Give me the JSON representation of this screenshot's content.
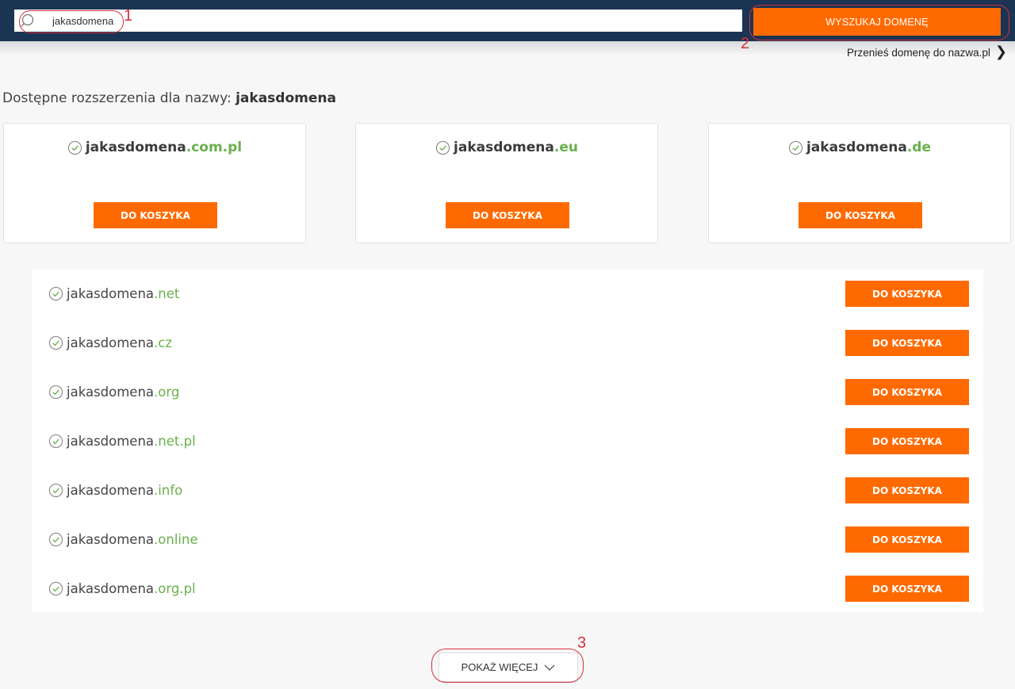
{
  "search": {
    "value": "jakasdomena",
    "button_label": "WYSZUKAJ DOMENĘ",
    "icon": "search-icon"
  },
  "transfer_link": {
    "label": "Przenieś domenę do nazwa.pl",
    "icon": "chevron-right-icon"
  },
  "heading": {
    "prefix": "Dostępne rozszerzenia dla nazwy: ",
    "name": "jakasdomena"
  },
  "featured": [
    {
      "name": "jakasdomena",
      "ext": ".com.pl",
      "button": "DO KOSZYKA"
    },
    {
      "name": "jakasdomena",
      "ext": ".eu",
      "button": "DO KOSZYKA"
    },
    {
      "name": "jakasdomena",
      "ext": ".de",
      "button": "DO KOSZYKA"
    }
  ],
  "domains": [
    {
      "name": "jakasdomena",
      "ext": ".net",
      "button": "DO KOSZYKA"
    },
    {
      "name": "jakasdomena",
      "ext": ".cz",
      "button": "DO KOSZYKA"
    },
    {
      "name": "jakasdomena",
      "ext": ".org",
      "button": "DO KOSZYKA"
    },
    {
      "name": "jakasdomena",
      "ext": ".net.pl",
      "button": "DO KOSZYKA"
    },
    {
      "name": "jakasdomena",
      "ext": ".info",
      "button": "DO KOSZYKA"
    },
    {
      "name": "jakasdomena",
      "ext": ".online",
      "button": "DO KOSZYKA"
    },
    {
      "name": "jakasdomena",
      "ext": ".org.pl",
      "button": "DO KOSZYKA"
    }
  ],
  "show_more": {
    "label": "POKAŻ WIĘCEJ",
    "icon": "chevron-down-icon"
  },
  "annotations": [
    "1",
    "2",
    "3"
  ],
  "colors": {
    "accent": "#ff6a00",
    "header": "#1b3453",
    "extension": "#6ab04c",
    "annotation": "#d6303b"
  }
}
